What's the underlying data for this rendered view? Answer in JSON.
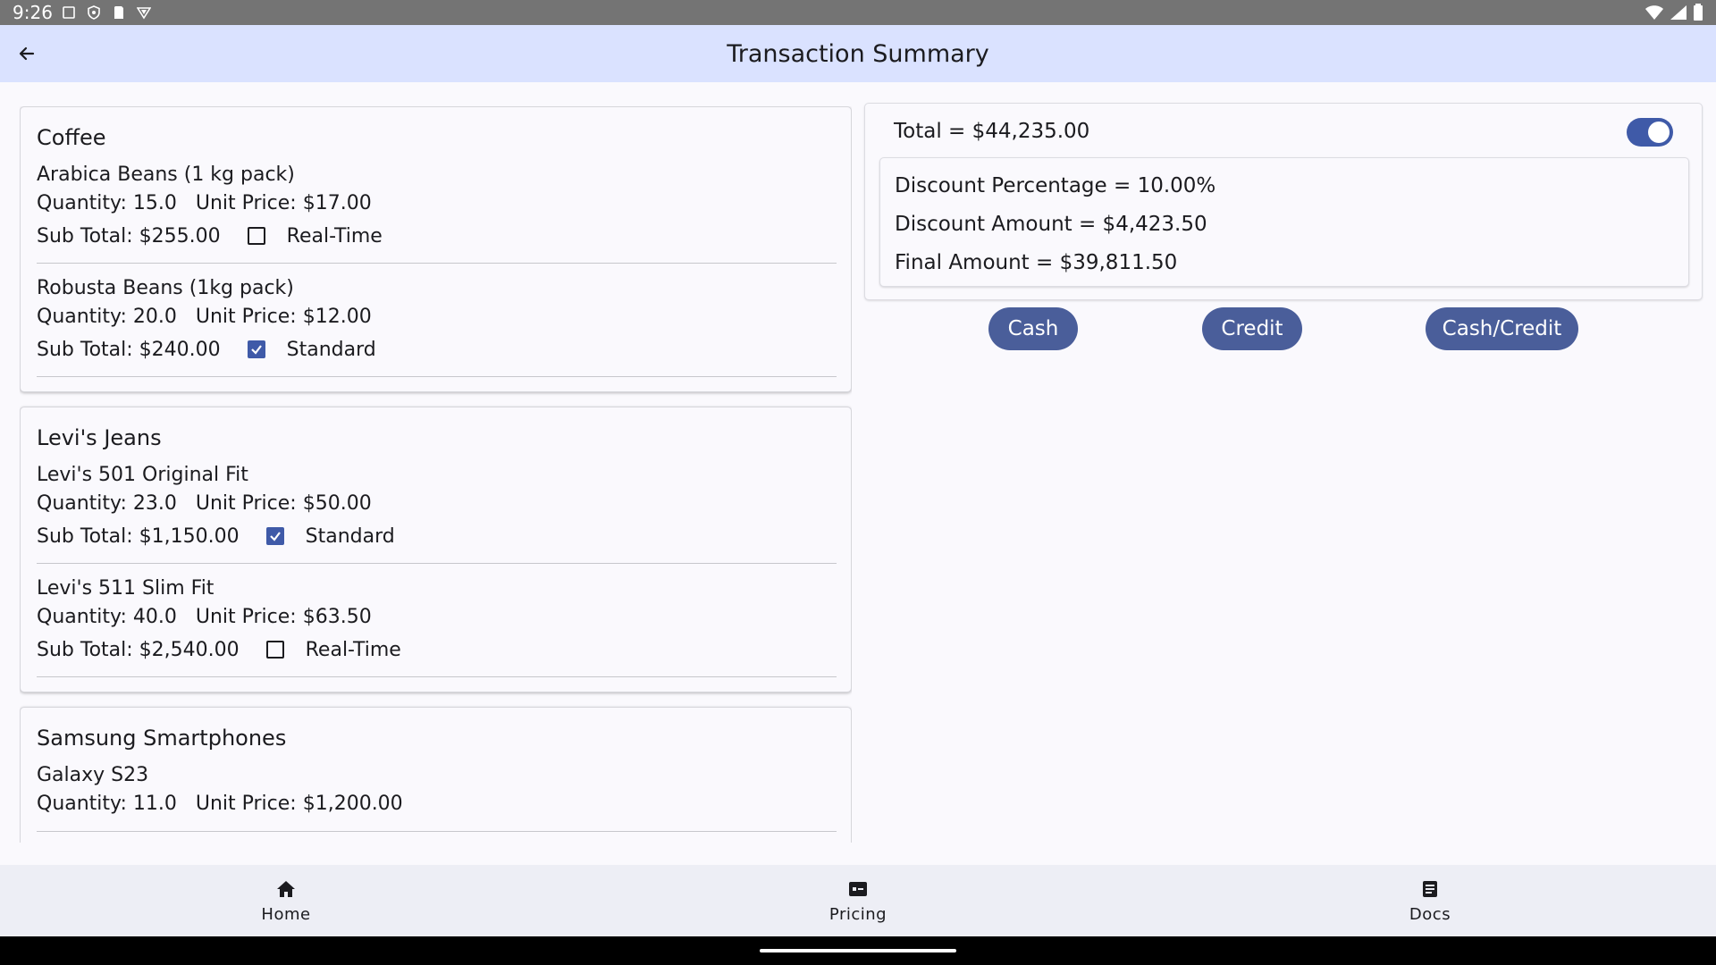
{
  "status_bar": {
    "time": "9:26"
  },
  "app_bar": {
    "title": "Transaction Summary"
  },
  "groups": [
    {
      "title": "Coffee",
      "items": [
        {
          "name": "Arabica Beans (1 kg pack)",
          "quantity": "Quantity: 15.0",
          "unit_price": "Unit Price: $17.00",
          "subtotal": "Sub Total: $255.00",
          "checked": false,
          "mode": "Real-Time"
        },
        {
          "name": "Robusta Beans (1kg pack)",
          "quantity": "Quantity: 20.0",
          "unit_price": "Unit Price: $12.00",
          "subtotal": "Sub Total: $240.00",
          "checked": true,
          "mode": "Standard"
        }
      ]
    },
    {
      "title": "Levi's Jeans",
      "items": [
        {
          "name": "Levi's 501 Original Fit",
          "quantity": "Quantity: 23.0",
          "unit_price": "Unit Price: $50.00",
          "subtotal": "Sub Total: $1,150.00",
          "checked": true,
          "mode": "Standard"
        },
        {
          "name": "Levi's 511 Slim Fit",
          "quantity": "Quantity: 40.0",
          "unit_price": "Unit Price: $63.50",
          "subtotal": "Sub Total: $2,540.00",
          "checked": false,
          "mode": "Real-Time"
        }
      ]
    },
    {
      "title": "Samsung Smartphones",
      "items": [
        {
          "name": "Galaxy S23",
          "quantity": "Quantity: 11.0",
          "unit_price": "Unit Price: $1,200.00"
        }
      ]
    }
  ],
  "summary": {
    "total": "Total = $44,235.00",
    "toggle_on": true,
    "discount_percentage": "Discount Percentage = 10.00%",
    "discount_amount": "Discount Amount = $4,423.50",
    "final_amount": "Final Amount = $39,811.50"
  },
  "payment_buttons": {
    "cash": "Cash",
    "credit": "Credit",
    "cash_credit": "Cash/Credit"
  },
  "bottom_nav": {
    "home": "Home",
    "pricing": "Pricing",
    "docs": "Docs"
  },
  "colors": {
    "accent": "#3f5aa8",
    "app_bar": "#dae2ff",
    "button": "#4a5e9a"
  }
}
